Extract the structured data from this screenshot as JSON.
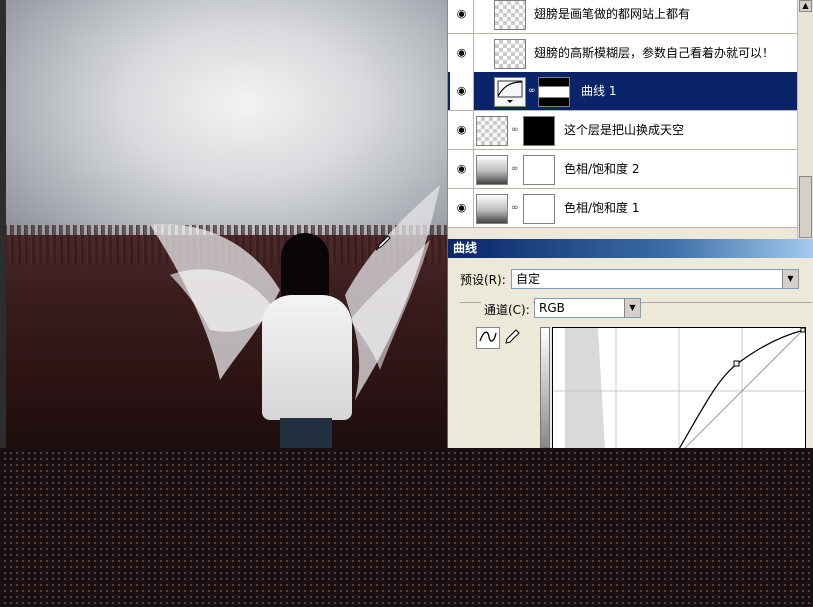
{
  "layers": [
    {
      "name": "翅膀是画笔做的都网站上都有",
      "thumb": "transparent",
      "mask": "none",
      "selected": false
    },
    {
      "name": "翅膀的高斯模糊层，参数自己看着办就可以！",
      "thumb": "transparent",
      "mask": "none",
      "selected": false
    },
    {
      "name": "曲线 1",
      "thumb": "curves-adjustment",
      "mask": "mixed",
      "selected": true
    },
    {
      "name": "这个层是把山换成天空",
      "thumb": "sky",
      "mask": "black",
      "selected": false
    },
    {
      "name": "色相/饱和度 2",
      "thumb": "hue-saturation",
      "mask": "white",
      "selected": false
    },
    {
      "name": "色相/饱和度 1",
      "thumb": "hue-saturation",
      "mask": "white",
      "selected": false
    }
  ],
  "curves": {
    "title": "曲线",
    "preset_label": "预设(R):",
    "preset_value": "自定",
    "channel_label": "通道(C):",
    "channel_value": "RGB",
    "curve_point": {
      "input": 186,
      "output": 237
    }
  },
  "icons": {
    "eye": "eye-icon",
    "link": "chain-link-icon",
    "curve_tool": "curve-point-tool-icon",
    "pencil_tool": "pencil-tool-icon",
    "eyedropper": "eyedropper-cursor-icon",
    "menu": "panel-menu-icon"
  },
  "colors": {
    "selection": "#0a246a",
    "panel": "#ece9d8",
    "background": "#1b1011"
  }
}
